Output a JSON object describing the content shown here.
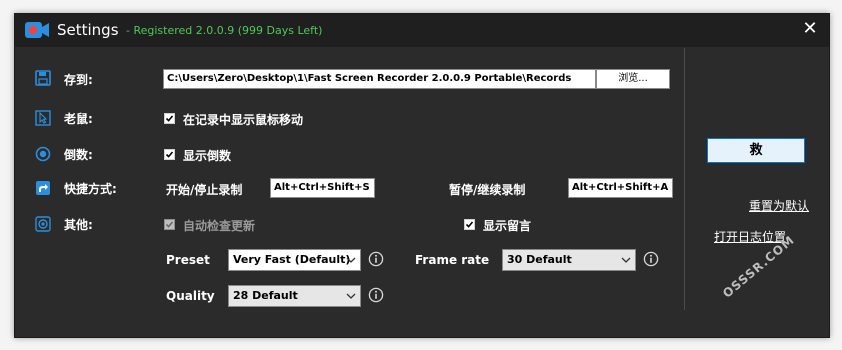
{
  "window": {
    "title": "Settings",
    "registration": "- Registered 2.0.0.9 (999 Days Left)",
    "close_glyph": "✕"
  },
  "save_to": {
    "label": "存到:",
    "path": "C:\\Users\\Zero\\Desktop\\1\\Fast Screen Recorder 2.0.0.9 Portable\\Records",
    "browse_label": "浏览..."
  },
  "mouse": {
    "label": "老鼠:",
    "option_label": "在记录中显示鼠标移动",
    "checked": true
  },
  "countdown": {
    "label": "倒数:",
    "option_label": "显示倒数",
    "checked": true
  },
  "hotkeys": {
    "label": "快捷方式:",
    "start_stop_label": "开始/停止录制",
    "start_stop_value": "Alt+Ctrl+Shift+S",
    "pause_resume_label": "暂停/继续录制",
    "pause_resume_value": "Alt+Ctrl+Shift+A"
  },
  "other": {
    "label": "其他:",
    "auto_update_label": "自动检查更新",
    "auto_update_checked": true,
    "auto_update_enabled": false,
    "show_comments_label": "显示留言",
    "show_comments_checked": true
  },
  "encoding": {
    "preset_label": "Preset",
    "preset_value": "Very Fast (Default)",
    "frame_rate_label": "Frame rate",
    "frame_rate_value": "30 Default",
    "quality_label": "Quality",
    "quality_value": "28 Default"
  },
  "actions": {
    "save_label": "救",
    "reset_label": "重置为默认",
    "open_log_label": "打开日志位置"
  },
  "watermark": "OSSSR.COM",
  "colors": {
    "window_bg": "#2b2b2b",
    "titlebar_bg": "#1f1f1f",
    "registration_text": "#4fc85a",
    "accent_icon": "#2b8fe0",
    "save_button_border": "#0078d7"
  },
  "icons": {
    "app": "video-camera-icon",
    "save_to": "floppy-disk-icon",
    "mouse": "cursor-icon",
    "countdown": "stopwatch-icon",
    "hotkeys": "shortcut-arrow-icon",
    "other": "gear-icon",
    "info": "info-circle-icon",
    "dropdown": "chevron-down-icon"
  }
}
